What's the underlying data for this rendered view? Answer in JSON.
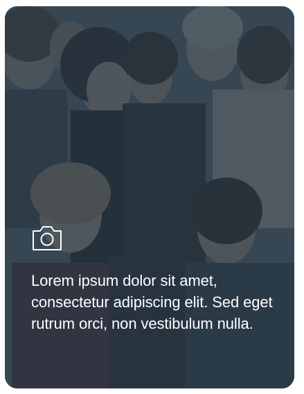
{
  "card": {
    "caption": "Lorem ipsum dolor sit amet, consectetur adipiscing elit. Sed eget rutrum orci, non vestibulum nulla.",
    "icon": "camera-icon",
    "overlay_color": "#263744",
    "text_color": "#ffffff"
  }
}
